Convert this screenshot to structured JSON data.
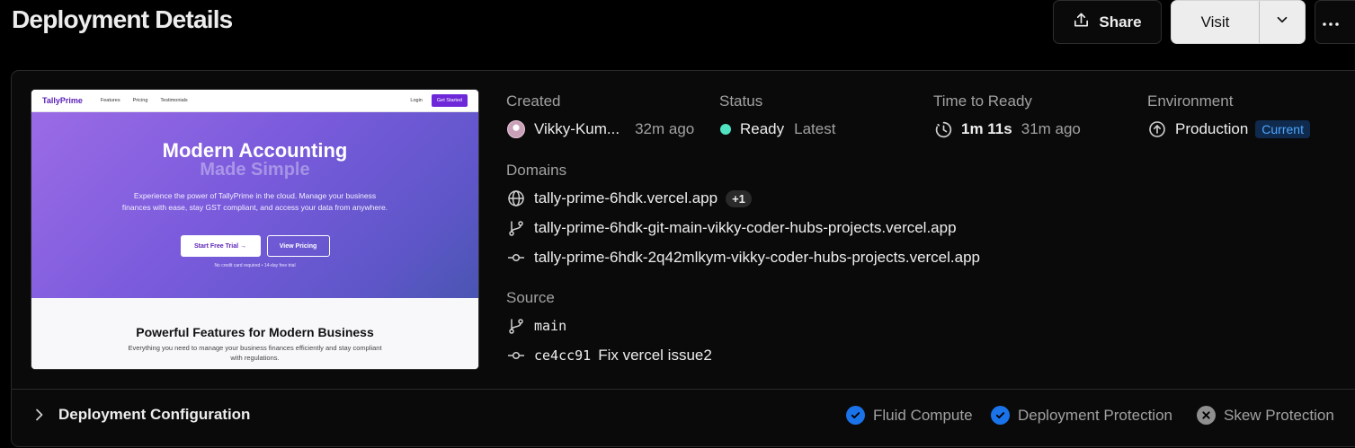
{
  "header": {
    "title": "Deployment Details",
    "share_label": "Share",
    "visit_label": "Visit"
  },
  "preview": {
    "nav": {
      "logo": "TallyPrime",
      "links": [
        "Features",
        "Pricing",
        "Testimonials"
      ],
      "login": "Login",
      "cta": "Get Started"
    },
    "hero_title": "Modern Accounting",
    "hero_subtitle": "Made Simple",
    "hero_desc": "Experience the power of TallyPrime in the cloud. Manage your business finances with ease, stay GST compliant, and access your data from anywhere.",
    "btn_primary": "Start Free Trial →",
    "btn_secondary": "View Pricing",
    "note": "No credit card required • 14-day free trial",
    "features_title": "Powerful Features for Modern Business",
    "features_desc": "Everything you need to manage your business finances efficiently and stay compliant with regulations."
  },
  "info": {
    "created_label": "Created",
    "created_user": "Vikky-Kum...",
    "created_time": "32m ago",
    "status_label": "Status",
    "status_value": "Ready",
    "status_tag": "Latest",
    "status_color": "#50e3c2",
    "time_label": "Time to Ready",
    "time_value": "1m 11s",
    "time_ago": "31m ago",
    "env_label": "Environment",
    "env_value": "Production",
    "env_badge": "Current",
    "domains_label": "Domains",
    "domains": [
      "tally-prime-6hdk.vercel.app",
      "tally-prime-6hdk-git-main-vikky-coder-hubs-projects.vercel.app",
      "tally-prime-6hdk-2q42mlkym-vikky-coder-hubs-projects.vercel.app"
    ],
    "domains_extra": "+1",
    "source_label": "Source",
    "branch": "main",
    "commit_hash": "ce4cc91",
    "commit_msg": "Fix vercel issue2"
  },
  "footer": {
    "config_label": "Deployment Configuration",
    "features": [
      {
        "label": "Fluid Compute",
        "enabled": true
      },
      {
        "label": "Deployment Protection",
        "enabled": true
      },
      {
        "label": "Skew Protection",
        "enabled": false
      }
    ],
    "accent_color": "#1a73e8"
  }
}
